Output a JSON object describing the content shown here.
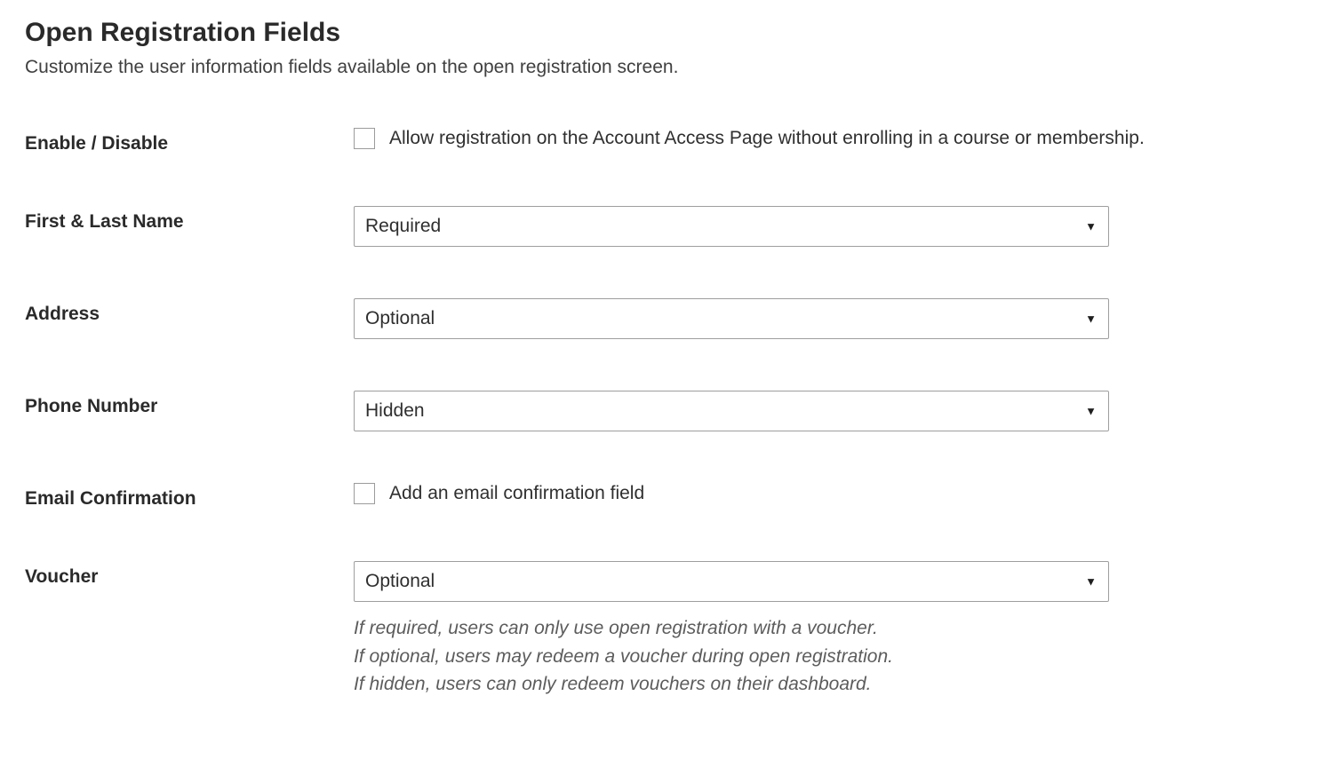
{
  "header": {
    "title": "Open Registration Fields",
    "description": "Customize the user information fields available on the open registration screen."
  },
  "fields": {
    "enable": {
      "label": "Enable / Disable",
      "checkbox_label": "Allow registration on the Account Access Page without enrolling in a course or membership.",
      "checked": false
    },
    "name": {
      "label": "First & Last Name",
      "value": "Required"
    },
    "address": {
      "label": "Address",
      "value": "Optional"
    },
    "phone": {
      "label": "Phone Number",
      "value": "Hidden"
    },
    "email_confirm": {
      "label": "Email Confirmation",
      "checkbox_label": "Add an email confirmation field",
      "checked": false
    },
    "voucher": {
      "label": "Voucher",
      "value": "Optional",
      "help1": "If required, users can only use open registration with a voucher.",
      "help2": "If optional, users may redeem a voucher during open registration.",
      "help3": "If hidden, users can only redeem vouchers on their dashboard."
    }
  }
}
